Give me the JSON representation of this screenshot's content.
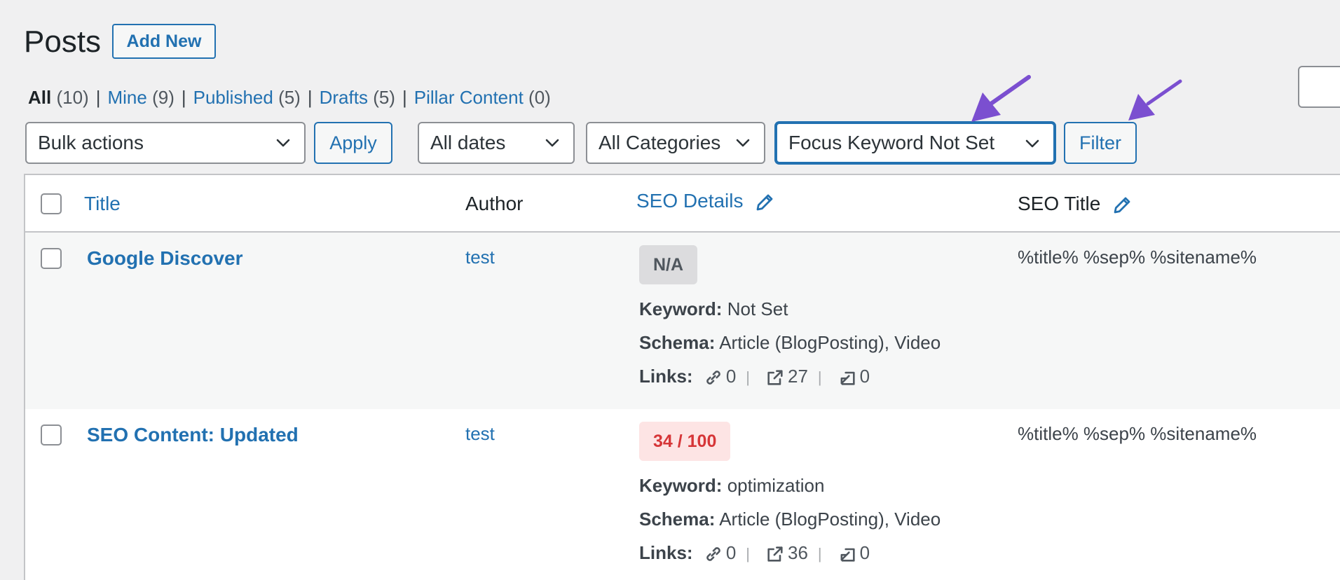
{
  "header": {
    "title": "Posts",
    "add_new": "Add New"
  },
  "views": [
    {
      "label": "All",
      "count": "(10)"
    },
    {
      "label": "Mine",
      "count": "(9)"
    },
    {
      "label": "Published",
      "count": "(5)"
    },
    {
      "label": "Drafts",
      "count": "(5)"
    },
    {
      "label": "Pillar Content",
      "count": "(0)"
    }
  ],
  "filters": {
    "bulk_actions": "Bulk actions",
    "apply": "Apply",
    "dates": "All dates",
    "categories": "All Categories",
    "focus_keyword": "Focus Keyword Not Set",
    "filter": "Filter"
  },
  "table": {
    "columns": {
      "title": "Title",
      "author": "Author",
      "seo_details": "SEO Details",
      "seo_title": "SEO Title"
    },
    "labels": {
      "keyword": "Keyword:",
      "schema": "Schema:",
      "links": "Links:"
    },
    "rows": [
      {
        "title": "Google Discover",
        "author": "test",
        "score": "N/A",
        "keyword": "Not Set",
        "schema": "Article (BlogPosting), Video",
        "internal_links": "0",
        "external_links": "27",
        "incoming_links": "0",
        "seo_title": "%title% %sep% %sitename%"
      },
      {
        "title": "SEO Content: Updated",
        "author": "test",
        "score": "34 / 100",
        "keyword": "optimization",
        "schema": "Article (BlogPosting), Video",
        "internal_links": "0",
        "external_links": "36",
        "incoming_links": "0",
        "seo_title": "%title% %sep% %sitename%"
      }
    ]
  },
  "colors": {
    "link": "#2271b1",
    "annotation_arrow": "#7b4fd0",
    "bad_score_bg": "#fde4e4",
    "bad_score_text": "#d63638"
  }
}
